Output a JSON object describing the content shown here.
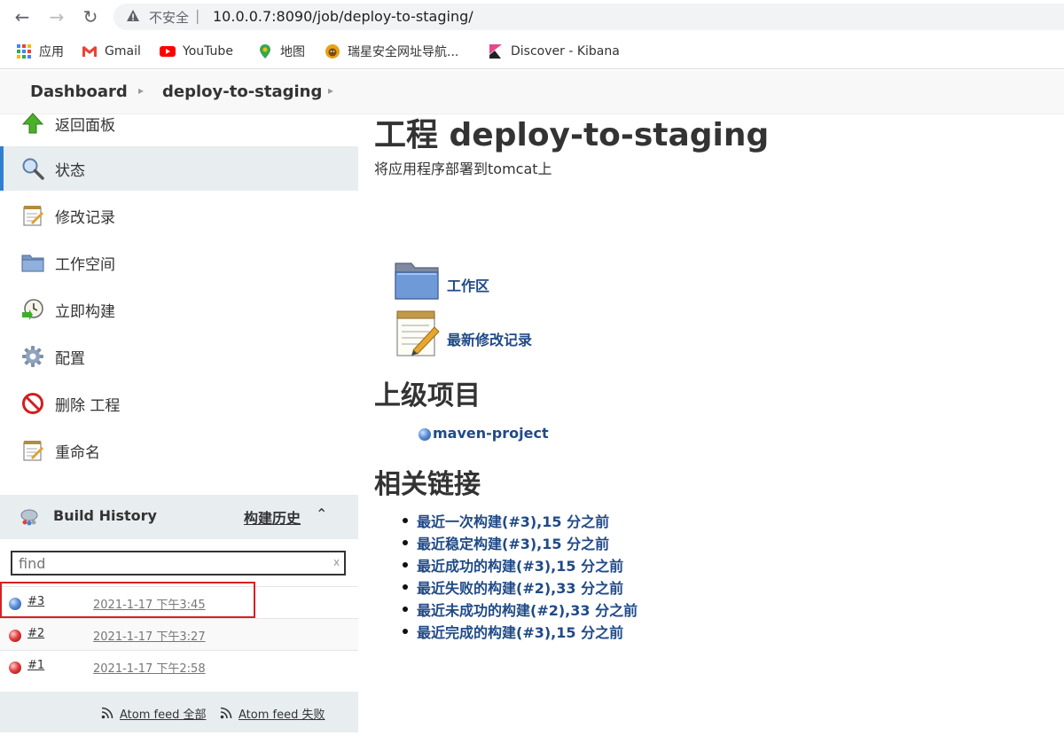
{
  "browser": {
    "insecure_label": "不安全",
    "url": "10.0.0.7:8090/job/deploy-to-staging/",
    "bookmarks": [
      {
        "label": "应用",
        "icon": "apps-grid-icon"
      },
      {
        "label": "Gmail",
        "icon": "gmail-icon"
      },
      {
        "label": "YouTube",
        "icon": "youtube-icon"
      },
      {
        "label": "地图",
        "icon": "maps-icon"
      },
      {
        "label": "瑞星安全网址导航...",
        "icon": "rising-lion-icon"
      },
      {
        "label": "Discover - Kibana",
        "icon": "kibana-icon"
      }
    ]
  },
  "breadcrumb": {
    "items": [
      "Dashboard",
      "deploy-to-staging"
    ]
  },
  "sidebar": {
    "tasks": [
      {
        "label": "返回面板",
        "icon": "up-arrow-icon"
      },
      {
        "label": "状态",
        "icon": "search-icon"
      },
      {
        "label": "修改记录",
        "icon": "notepad-icon"
      },
      {
        "label": "工作空间",
        "icon": "folder-icon"
      },
      {
        "label": "立即构建",
        "icon": "clock-build-icon"
      },
      {
        "label": "配置",
        "icon": "gear-icon"
      },
      {
        "label": "删除 工程",
        "icon": "no-entry-icon"
      },
      {
        "label": "重命名",
        "icon": "notepad-icon"
      }
    ],
    "active_index": 1
  },
  "build_history": {
    "title": "Build History",
    "trend_label": "构建历史",
    "search_placeholder": "find",
    "clear_label": "x",
    "builds": [
      {
        "number": "#3",
        "time": "2021-1-17 下午3:45",
        "status": "blue"
      },
      {
        "number": "#2",
        "time": "2021-1-17 下午3:27",
        "status": "red"
      },
      {
        "number": "#1",
        "time": "2021-1-17 下午2:58",
        "status": "red"
      }
    ],
    "feed_all": "Atom feed 全部",
    "feed_failed": "Atom feed 失败"
  },
  "main": {
    "title": "工程 deploy-to-staging",
    "description": "将应用程序部署到tomcat上",
    "workspace_link": "工作区",
    "changes_link": "最新修改记录",
    "upstream_heading": "上级项目",
    "upstream_project": "maven-project",
    "permalinks_heading": "相关链接",
    "permalinks": [
      "最近一次构建(#3),15 分之前",
      "最近稳定构建(#3),15 分之前",
      "最近成功的构建(#3),15 分之前",
      "最近失败的构建(#2),33 分之前",
      "最近未成功的构建(#2),33 分之前",
      "最近完成的构建(#3),15 分之前"
    ]
  }
}
